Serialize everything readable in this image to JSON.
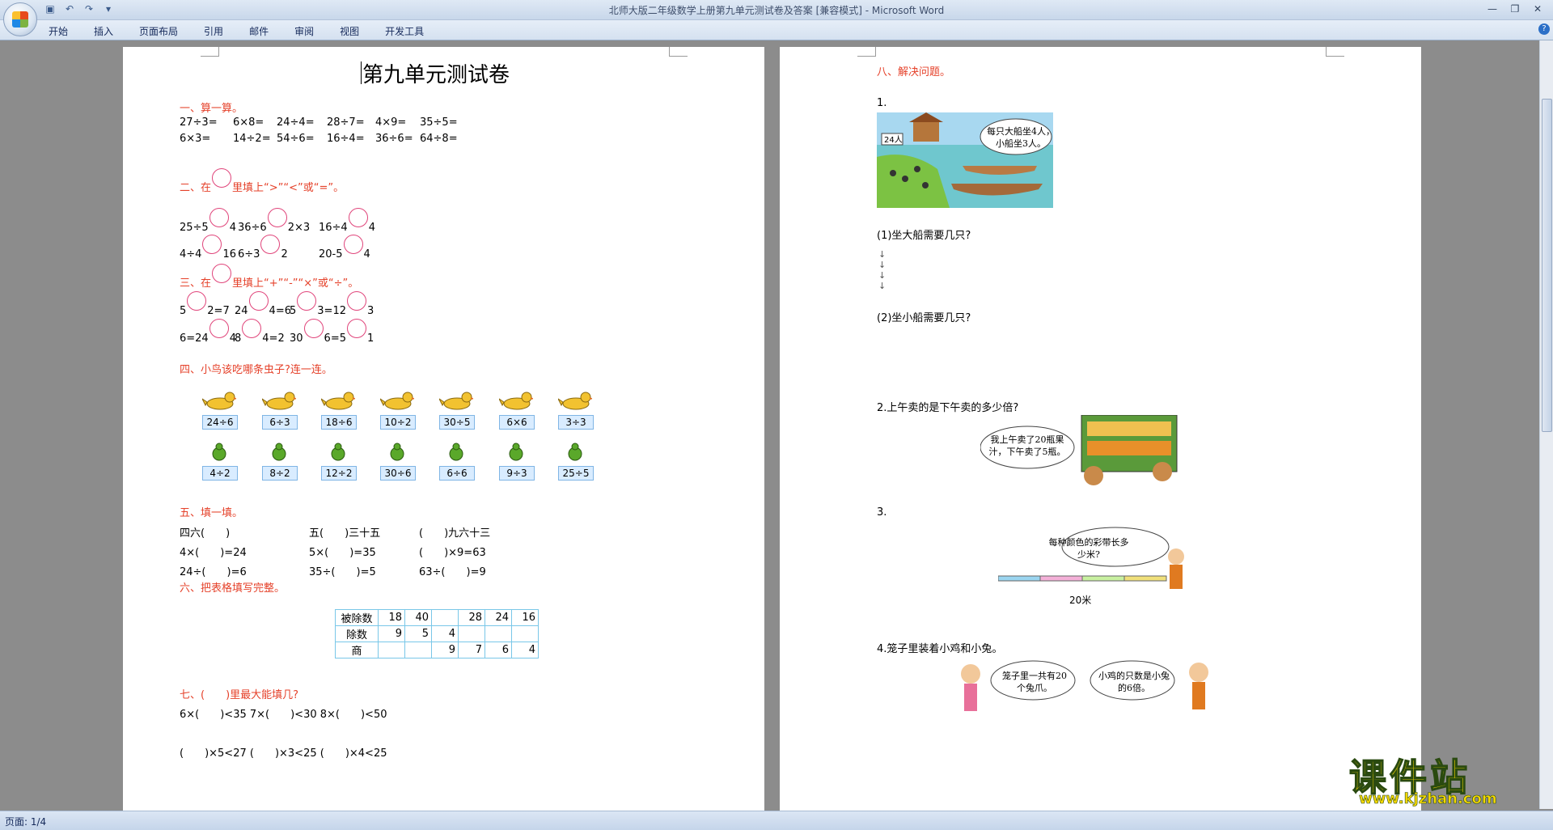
{
  "window": {
    "title": "北师大版二年级数学上册第九单元测试卷及答案 [兼容模式] - Microsoft Word"
  },
  "menu": [
    "开始",
    "插入",
    "页面布局",
    "引用",
    "邮件",
    "审阅",
    "视图",
    "开发工具"
  ],
  "status": {
    "page": "页面: 1/4"
  },
  "watermark": {
    "text": "课件站",
    "url": "www.kjzhan.com"
  },
  "page1": {
    "title": "第九单元测试卷",
    "s1": {
      "heading": "一、算一算。",
      "row1": [
        "27÷3=",
        "6×8=",
        "24÷4=",
        "28÷7=",
        "4×9=",
        "35÷5="
      ],
      "row2": [
        "6×3=",
        "14÷2=",
        "54÷6=",
        "16÷4=",
        "36÷6=",
        "64÷8="
      ]
    },
    "s2": {
      "heading_pre": "二、在",
      "heading_post": "里填上“>”“<”或“=”。",
      "r1": [
        [
          "25÷5",
          "4"
        ],
        [
          "36÷6",
          "2×3"
        ],
        [
          "16÷4",
          "4"
        ]
      ],
      "r2": [
        [
          "4÷4",
          "16"
        ],
        [
          "6÷3",
          "2"
        ],
        [
          "20-5",
          "4"
        ]
      ]
    },
    "s3": {
      "heading_pre": "三、在",
      "heading_post": "里填上“+”“-”“×”或“÷”。",
      "r1": [
        "5",
        "2=7",
        "24",
        "4=6",
        "5",
        "3=12",
        "3"
      ],
      "r2": [
        "6=24",
        "4",
        "8",
        "4=2",
        "30",
        "6=5",
        "1"
      ]
    },
    "s4": {
      "heading": "四、小鸟该吃哪条虫子?连一连。",
      "birds": [
        "24÷6",
        "6÷3",
        "18÷6",
        "10÷2",
        "30÷5",
        "6×6",
        "3÷3"
      ],
      "bugs": [
        "4÷2",
        "8÷2",
        "12÷2",
        "30÷6",
        "6÷6",
        "9÷3",
        "25÷5"
      ]
    },
    "s5": {
      "heading": "五、填一填。",
      "r1": [
        "四六(　　)",
        "五(　　)三十五",
        "(　　)九六十三"
      ],
      "r2": [
        "4×(　　)=24",
        "5×(　　)=35",
        "(　　)×9=63"
      ],
      "r3": [
        "24÷(　　)=6",
        "35÷(　　)=5",
        "63÷(　　)=9"
      ]
    },
    "s6": {
      "heading": "六、把表格填写完整。",
      "table": [
        [
          "被除数",
          "18",
          "40",
          "",
          "28",
          "24",
          "16"
        ],
        [
          "除数",
          "9",
          "5",
          "4",
          "",
          "",
          ""
        ],
        [
          "商",
          "",
          "",
          "9",
          "7",
          "6",
          "4"
        ]
      ]
    },
    "s7": {
      "heading": "七、(　　)里最大能填几?",
      "r1": "6×(　　)<35  7×(　　)<30  8×(　　)<50",
      "r2": "(　　)×5<27  (　　)×3<25  (　　)×4<25"
    }
  },
  "page2": {
    "heading": "八、解决问题。",
    "q1": "1.",
    "q1_img": {
      "sign": "24人",
      "bubble": "每只大船坐4人，小船坐3人。"
    },
    "q1a": "(1)坐大船需要几只?",
    "q1b": "(2)坐小船需要几只?",
    "q2": "2.上午卖的是下午卖的多少倍?",
    "q2_bubble": "我上午卖了20瓶果汁，下午卖了5瓶。",
    "q3": "3.",
    "q3_bubble": "每种颜色的彩带长多少米?",
    "q3_len": "20米",
    "q4": "4.笼子里装着小鸡和小兔。",
    "q4_bubble1": "笼子里一共有20个兔爪。",
    "q4_bubble2": "小鸡的只数是小兔的6倍。"
  }
}
